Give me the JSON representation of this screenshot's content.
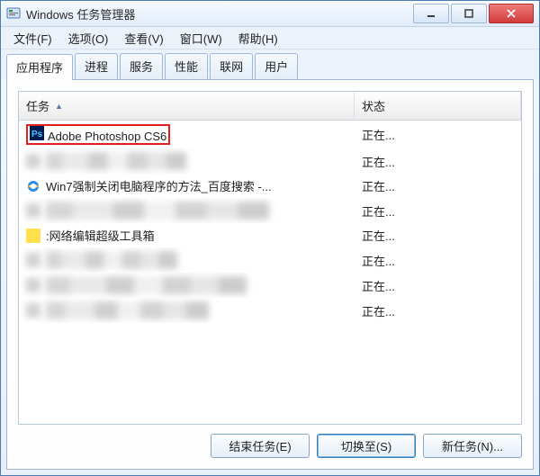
{
  "window": {
    "title": "Windows 任务管理器"
  },
  "menu": {
    "file": "文件(F)",
    "options": "选项(O)",
    "view": "查看(V)",
    "window": "窗口(W)",
    "help": "帮助(H)"
  },
  "tabs": {
    "apps": "应用程序",
    "processes": "进程",
    "services": "服务",
    "performance": "性能",
    "network": "联网",
    "users": "用户"
  },
  "list": {
    "header_task": "任务",
    "header_status": "状态",
    "rows": [
      {
        "icon": "ps",
        "task": "Adobe Photoshop CS6",
        "status": "正在...",
        "highlight": true,
        "blurred": false
      },
      {
        "icon": "blur",
        "task": "",
        "status": "正在...",
        "highlight": false,
        "blurred": true
      },
      {
        "icon": "ie",
        "task": "Win7强制关闭电脑程序的方法_百度搜索 -...",
        "status": "正在...",
        "highlight": false,
        "blurred": false
      },
      {
        "icon": "blur",
        "task": "",
        "status": "正在...",
        "highlight": false,
        "blurred": true
      },
      {
        "icon": "yellow",
        "task": ":网络编辑超级工具箱",
        "status": "正在...",
        "highlight": false,
        "blurred": false
      },
      {
        "icon": "blur",
        "task": "",
        "status": "正在...",
        "highlight": false,
        "blurred": true
      },
      {
        "icon": "blur",
        "task": "",
        "status": "正在...",
        "highlight": false,
        "blurred": true
      },
      {
        "icon": "blur",
        "task": "",
        "status": "正在...",
        "highlight": false,
        "blurred": true
      }
    ]
  },
  "buttons": {
    "end_task": "结束任务(E)",
    "switch_to": "切换至(S)",
    "new_task": "新任务(N)..."
  }
}
